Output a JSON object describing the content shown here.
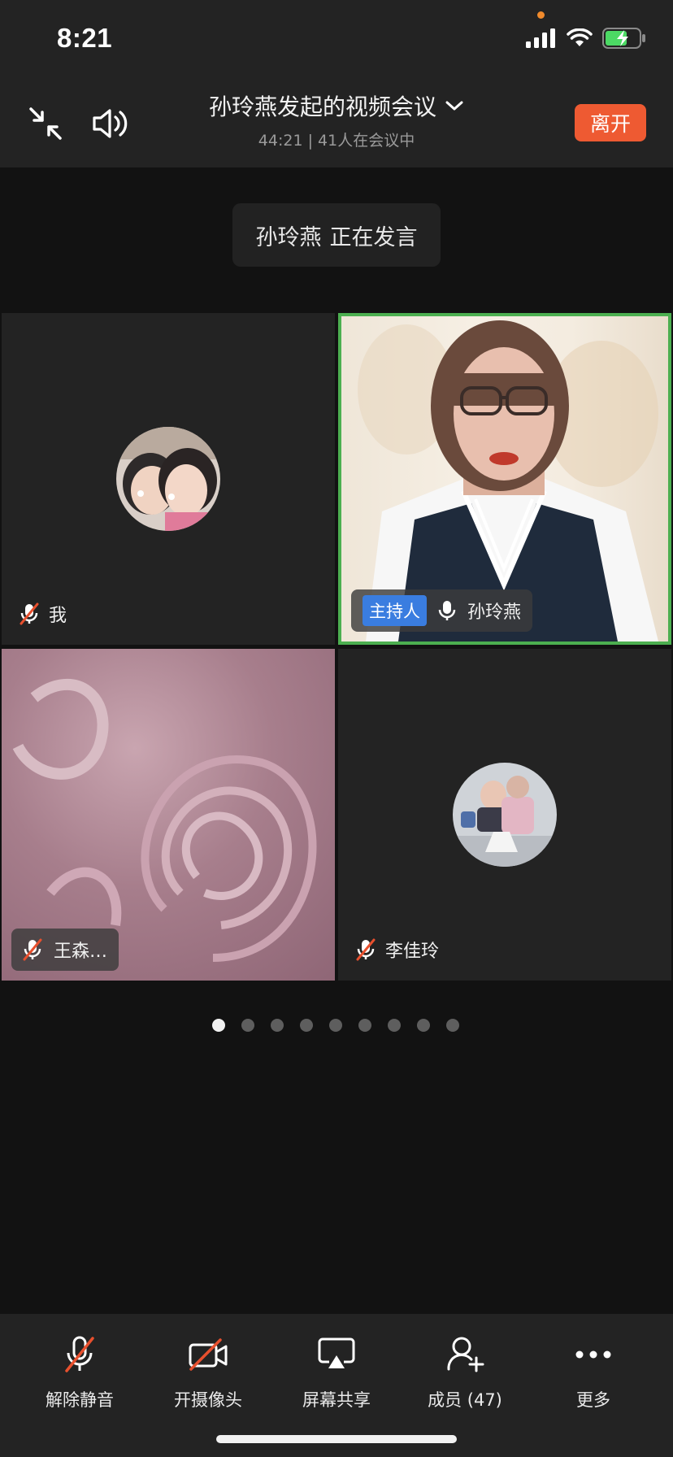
{
  "status_bar": {
    "time": "8:21"
  },
  "header": {
    "title": "孙玲燕发起的视频会议",
    "subtitle": "44:21 | 41人在会议中",
    "leave_label": "离开"
  },
  "speaking": {
    "name": "孙玲燕",
    "text": "正在发言"
  },
  "tiles": [
    {
      "name": "我",
      "mic": "muted",
      "video": "off"
    },
    {
      "name": "孙玲燕",
      "badge": "主持人",
      "mic": "on",
      "video": "on",
      "active_speaker": true
    },
    {
      "name": "王森…",
      "mic": "muted",
      "video": "on"
    },
    {
      "name": "李佳玲",
      "mic": "muted",
      "video": "off"
    }
  ],
  "pagination": {
    "total": 9,
    "current": 1
  },
  "toolbar": {
    "unmute_label": "解除静音",
    "camera_label": "开摄像头",
    "share_label": "屏幕共享",
    "members_label": "成员 (47)",
    "more_label": "更多"
  },
  "colors": {
    "leave": "#ee5a32",
    "host_badge": "#3a7de0",
    "speaker_border": "#4caf50"
  },
  "icons": [
    "minimize-icon",
    "speaker-icon",
    "chevron-down-icon",
    "mic-muted-icon",
    "mic-icon",
    "camera-off-icon",
    "screen-share-icon",
    "add-member-icon",
    "more-icon"
  ]
}
